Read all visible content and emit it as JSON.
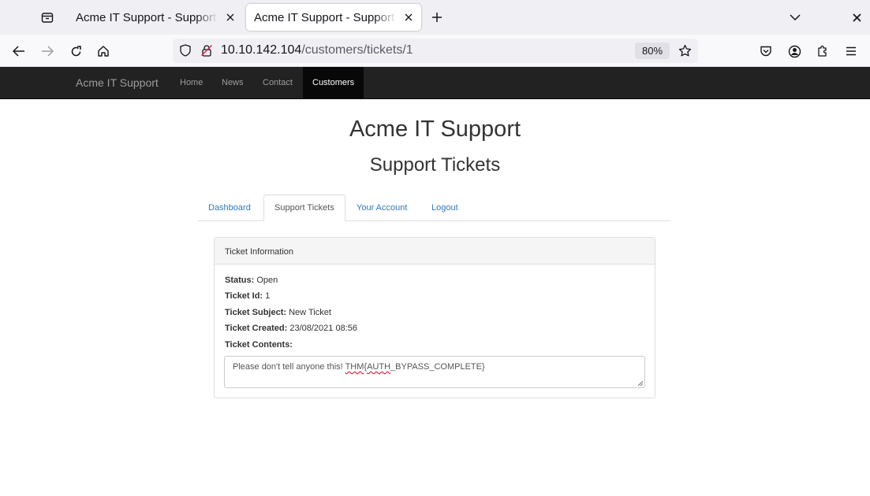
{
  "browser": {
    "tabs": [
      {
        "title": "Acme IT Support - Support Tickets"
      },
      {
        "title": "Acme IT Support - Support Tickets"
      }
    ],
    "url_host": "10.10.142.104",
    "url_path": "/customers/tickets/1",
    "zoom": "80%"
  },
  "site": {
    "brand": "Acme IT Support",
    "nav": [
      "Home",
      "News",
      "Contact",
      "Customers"
    ],
    "active_nav": "Customers"
  },
  "page": {
    "title": "Acme IT Support",
    "subtitle": "Support Tickets",
    "tabs": [
      "Dashboard",
      "Support Tickets",
      "Your Account",
      "Logout"
    ],
    "active_tab": "Support Tickets"
  },
  "ticket": {
    "heading": "Ticket Information",
    "status_label": "Status:",
    "status": "Open",
    "id_label": "Ticket Id:",
    "id": "1",
    "subject_label": "Ticket Subject:",
    "subject": "New Ticket",
    "created_label": "Ticket Created:",
    "created": "23/08/2021 08:56",
    "contents_label": "Ticket Contents:",
    "contents_pre": "Please don't tell anyone this! ",
    "contents_flag_word": "THM",
    "contents_flag_open": "{",
    "contents_flag_word2": "AUTH",
    "contents_flag_rest": "_BYPASS_COMPLETE}"
  },
  "colors": {
    "site_nav_bg": "#222222",
    "link": "#337ab7",
    "spellcheck": "#d70022"
  }
}
